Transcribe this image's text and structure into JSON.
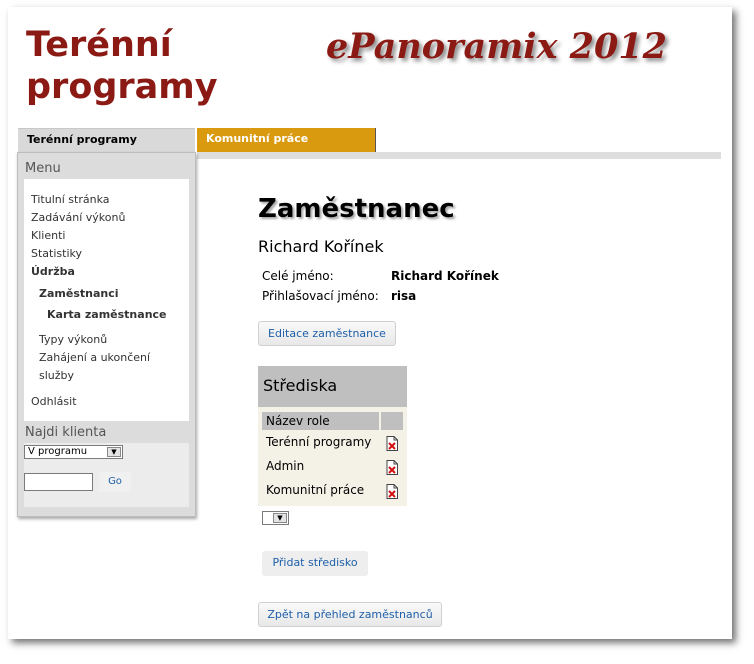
{
  "header": {
    "site_title_line1": "Terénní",
    "site_title_line2": "programy",
    "brand": "ePanoramix 2012"
  },
  "tabs": {
    "left": "Terénní programy",
    "active": "Komunitní práce"
  },
  "sidebar": {
    "menu_heading": "Menu",
    "items": [
      {
        "label": "Titulní stránka"
      },
      {
        "label": "Zadávání výkonů"
      },
      {
        "label": "Klienti"
      },
      {
        "label": "Statistiky"
      },
      {
        "label": "Údržba"
      },
      {
        "label": "Zaměstnanci"
      },
      {
        "label": "Karta zaměstnance"
      },
      {
        "label": "Typy výkonů"
      },
      {
        "label": "Zahájení a ukončení"
      },
      {
        "label": "služby"
      },
      {
        "label": "Odhlásit"
      }
    ],
    "search_heading": "Najdi klienta",
    "search_select": "V programu",
    "search_input_value": "",
    "go_label": "Go"
  },
  "main": {
    "title": "Zaměstnanec",
    "name": "Richard Kořínek",
    "fields": [
      {
        "label": "Celé jméno:",
        "value": "Richard Kořínek"
      },
      {
        "label": "Přihlašovací jméno:",
        "value": "risa"
      }
    ],
    "edit_button": "Editace zaměstnance",
    "centers_heading": "Střediska",
    "column_role": "Název role",
    "roles": [
      "Terénní programy",
      "Admin",
      "Komunitní práce"
    ],
    "center_select_value": "",
    "add_button": "Přidat středisko",
    "back_button": "Zpět na přehled zaměstnanců"
  },
  "colors": {
    "title_red": "#8b1a14",
    "tab_active": "#d99a0f",
    "link_blue": "#1e5fa8"
  }
}
